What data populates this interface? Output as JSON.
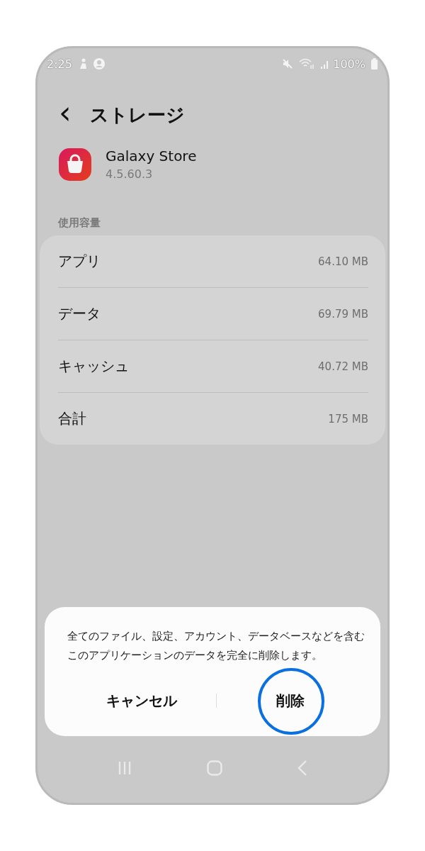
{
  "status_bar": {
    "time": "2:25",
    "battery": "100%"
  },
  "header": {
    "back": "‹",
    "title": "ストレージ"
  },
  "app": {
    "name": "Galaxy Store",
    "version": "4.5.60.3"
  },
  "section": {
    "title": "使用容量"
  },
  "usage": [
    {
      "label": "アプリ",
      "value": "64.10 MB"
    },
    {
      "label": "データ",
      "value": "69.79 MB"
    },
    {
      "label": "キャッシュ",
      "value": "40.72 MB"
    },
    {
      "label": "合計",
      "value": "175 MB"
    }
  ],
  "dialog": {
    "message": "全てのファイル、設定、アカウント、データベースなどを含むこのアプリケーションのデータを完全に削除します。",
    "buttons": [
      {
        "label": "キャンセル",
        "tapped": false
      },
      {
        "label": "削除",
        "tapped": true
      }
    ]
  }
}
